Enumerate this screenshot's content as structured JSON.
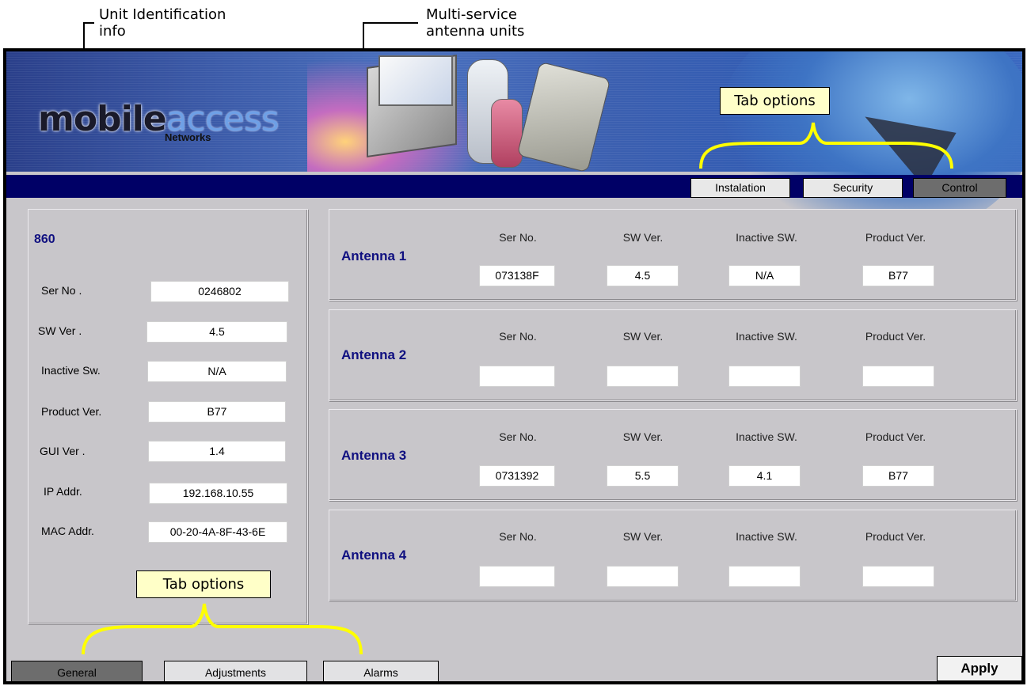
{
  "callouts": {
    "unit_id": [
      "Unit Identification",
      "info"
    ],
    "antenna_units": [
      "Multi-service",
      "antenna units"
    ],
    "tab_options_top": "Tab options",
    "tab_options_bottom": "Tab options"
  },
  "banner": {
    "logo_part1": "mobile",
    "logo_part2": "access",
    "logo_sub": "Networks"
  },
  "top_tabs": [
    {
      "label": "Instalation",
      "state": "normal"
    },
    {
      "label": "Security",
      "state": "normal"
    },
    {
      "label": "Control",
      "state": "selected"
    }
  ],
  "unit": {
    "title": "860",
    "fields": [
      {
        "label": "Ser No .",
        "value": "0246802"
      },
      {
        "label": "SW Ver .",
        "value": "4.5"
      },
      {
        "label": "Inactive Sw.",
        "value": "N/A"
      },
      {
        "label": "Product Ver.",
        "value": "B77"
      },
      {
        "label": "GUI Ver .",
        "value": "1.4"
      },
      {
        "label": "IP Addr.",
        "value": "192.168.10.55"
      },
      {
        "label": "MAC Addr.",
        "value": "00-20-4A-8F-43-6E"
      }
    ]
  },
  "antenna_columns": [
    "Ser No.",
    "SW Ver.",
    "Inactive SW.",
    "Product Ver."
  ],
  "antennas": [
    {
      "name": "Antenna 1",
      "values": [
        "073138F",
        "4.5",
        "N/A",
        "B77"
      ]
    },
    {
      "name": "Antenna 2",
      "values": [
        "",
        "",
        "",
        ""
      ]
    },
    {
      "name": "Antenna 3",
      "values": [
        "0731392",
        "5.5",
        "4.1",
        "B77"
      ]
    },
    {
      "name": "Antenna 4",
      "values": [
        "",
        "",
        "",
        ""
      ]
    }
  ],
  "bottom_tabs": [
    {
      "label": "General",
      "state": "selected"
    },
    {
      "label": "Adjustments",
      "state": "normal"
    },
    {
      "label": "Alarms",
      "state": "normal"
    }
  ],
  "apply_label": "Apply",
  "colors": {
    "navbar": "#000066",
    "panel_bg": "#c8c6ca",
    "title_blue": "#101080",
    "note_bg": "#ffffc8",
    "brace": "#ffff00"
  }
}
